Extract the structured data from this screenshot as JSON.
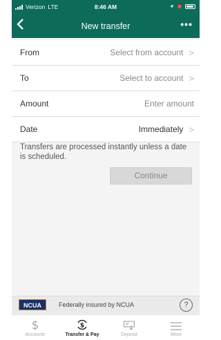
{
  "status": {
    "carrier": "Verizon",
    "network": "LTE",
    "time": "8:46 AM"
  },
  "nav": {
    "back_glyph": "<",
    "title": "New transfer",
    "more_glyph": "•••"
  },
  "form": {
    "rows": [
      {
        "label": "From",
        "value": "Select from account",
        "chevron": ">"
      },
      {
        "label": "To",
        "value": "Select to account",
        "chevron": ">"
      },
      {
        "label": "Amount",
        "placeholder": "Enter amount"
      },
      {
        "label": "Date",
        "value": "Immediately",
        "chevron": ">"
      }
    ]
  },
  "note": "Transfers are processed instantly unless a date is scheduled.",
  "continue_label": "Continue",
  "ncua": {
    "logo_text": "NCUA",
    "text": "Federally insured by NCUA",
    "help_glyph": "?"
  },
  "tabs": [
    {
      "label": "Accounts",
      "icon": "dollar-icon"
    },
    {
      "label": "Transfer & Pay",
      "icon": "transfer-pay-icon",
      "active": true
    },
    {
      "label": "Deposit",
      "icon": "deposit-check-icon"
    },
    {
      "label": "More",
      "icon": "menu-icon"
    }
  ],
  "colors": {
    "header": "#0c6b59",
    "ncua_logo": "#1a2f6b"
  }
}
